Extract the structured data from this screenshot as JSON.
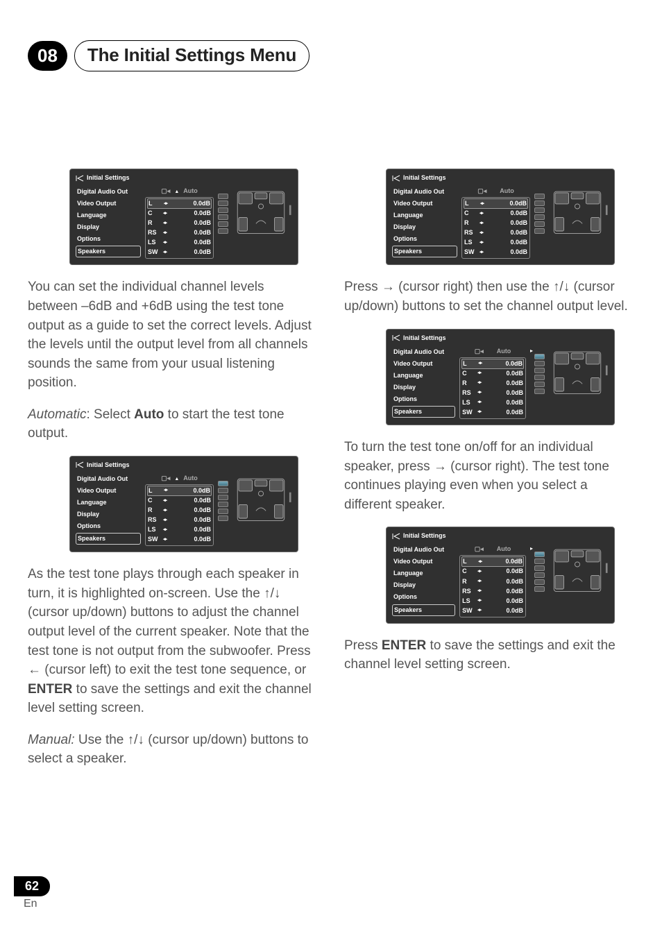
{
  "header": {
    "chapter_number": "08",
    "chapter_title": "The Initial Settings Menu"
  },
  "footer": {
    "page_number": "62",
    "lang": "En"
  },
  "osd_common": {
    "title": "Initial Settings",
    "menu_items": [
      "Digital Audio Out",
      "Video Output",
      "Language",
      "Display",
      "Options",
      "Speakers"
    ],
    "selected_menu_index": 5,
    "mode_label": "Auto",
    "channels": [
      {
        "ch": "L",
        "val": "0.0dB"
      },
      {
        "ch": "C",
        "val": "0.0dB"
      },
      {
        "ch": "R",
        "val": "0.0dB"
      },
      {
        "ch": "RS",
        "val": "0.0dB"
      },
      {
        "ch": "LS",
        "val": "0.0dB"
      },
      {
        "ch": "SW",
        "val": "0.0dB"
      }
    ]
  },
  "osd_variants": {
    "a": {
      "arrow": "up",
      "active_slider": null,
      "show_dot": false
    },
    "b": {
      "arrow": "up",
      "active_slider": 0,
      "show_dot": false
    },
    "c": {
      "arrow": "none",
      "active_slider": null,
      "show_dot": false
    },
    "d": {
      "arrow": "none",
      "active_slider": 0,
      "show_dot": true
    },
    "e": {
      "arrow": "none",
      "active_slider": 0,
      "show_dot": true
    }
  },
  "left_col": {
    "p1": "You can set the individual channel levels between –6dB and +6dB using the test tone output as a guide to set the correct levels. Adjust the levels until the output level from all channels sounds the same from your usual listening position.",
    "auto_prefix": "Automatic",
    "auto_mid": ": Select ",
    "auto_bold": "Auto",
    "auto_suffix": " to start the test tone output.",
    "p2a": "As the test tone plays through each speaker in turn, it is highlighted on-screen. Use the ",
    "p2b": " (cursor up/down) buttons to adjust the channel output level of the current speaker. Note that the test tone is not output from the subwoofer. Press ",
    "p2c": " (cursor left) to exit the test tone sequence, or ",
    "p2_enter": "ENTER",
    "p2d": " to save the settings and exit the channel level setting screen.",
    "manual_prefix": "Manual:",
    "manual_mid": " Use the ",
    "manual_suffix": " (cursor up/down) buttons to select a speaker."
  },
  "right_col": {
    "r1a": "Press ",
    "r1b": " (cursor right) then use the ",
    "r1c": " (cursor up/down) buttons to set the channel output level.",
    "r2a": "To turn the test tone on/off for an individual speaker, press ",
    "r2b": " (cursor right). The test tone continues playing even when you select a different speaker.",
    "r3a": "Press ",
    "r3_enter": "ENTER",
    "r3b": " to save the settings and exit the channel level setting screen."
  },
  "glyphs": {
    "up_down": "↑/↓",
    "right": "→",
    "left": "←"
  }
}
